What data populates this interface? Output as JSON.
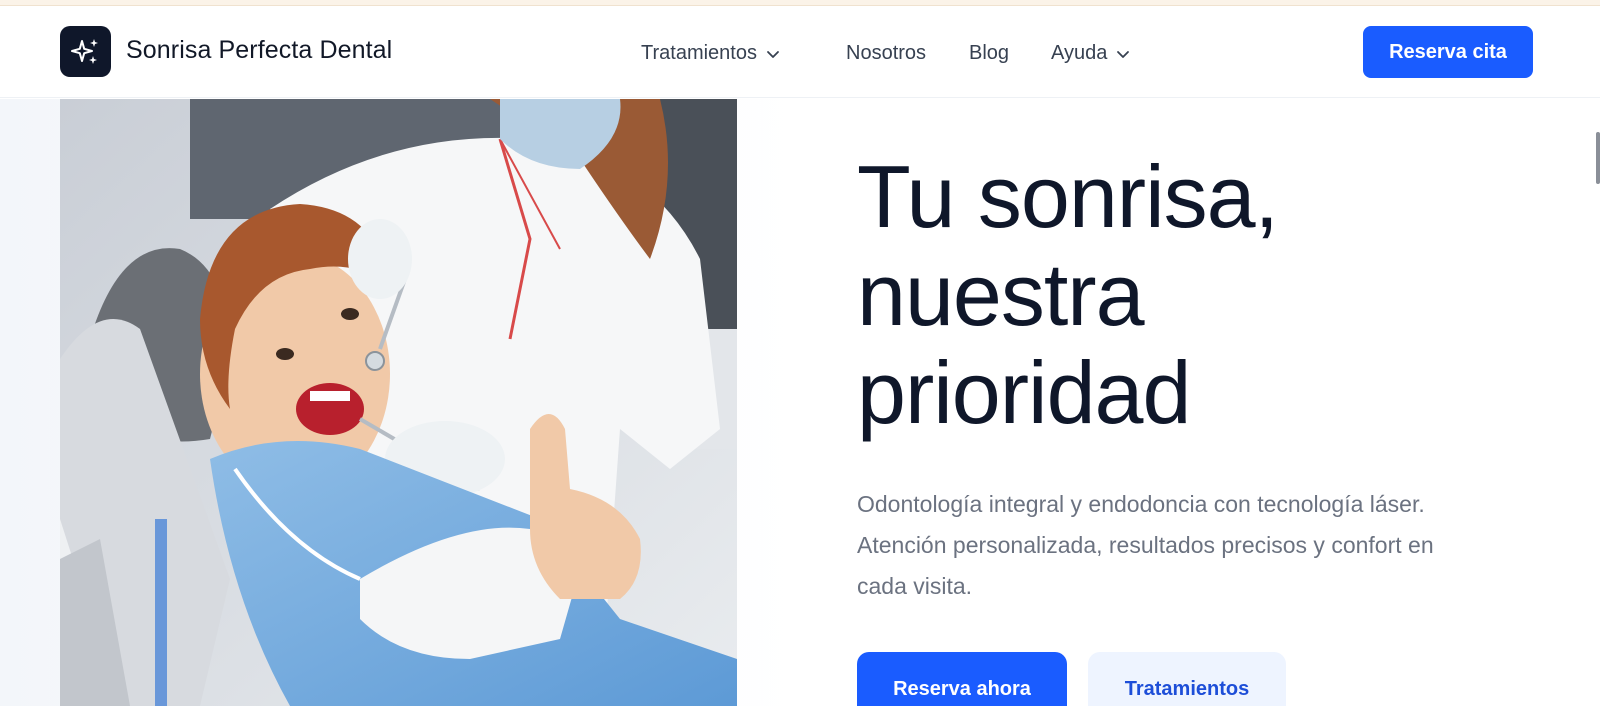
{
  "header": {
    "brand_name": "Sonrisa Perfecta Dental",
    "logo_icon": "sparkles-icon",
    "nav": [
      {
        "label": "Tratamientos",
        "has_dropdown": true
      },
      {
        "label": "Nosotros",
        "has_dropdown": false
      },
      {
        "label": "Blog",
        "has_dropdown": false
      },
      {
        "label": "Ayuda",
        "has_dropdown": true
      }
    ],
    "cta_label": "Reserva cita"
  },
  "hero": {
    "headline_lines": [
      "Tu sonrisa,",
      "nuestra",
      "prioridad"
    ],
    "subtext": "Odontología integral y endodoncia con tecnología láser. Atención personalizada, resultados precisos y confort en cada visita.",
    "primary_button": "Reserva ahora",
    "secondary_button": "Tratamientos"
  },
  "colors": {
    "accent": "#1a5cff",
    "text_dark": "#0f172a",
    "text_muted": "#6b7280",
    "secondary_button_bg": "#eef4ff"
  }
}
